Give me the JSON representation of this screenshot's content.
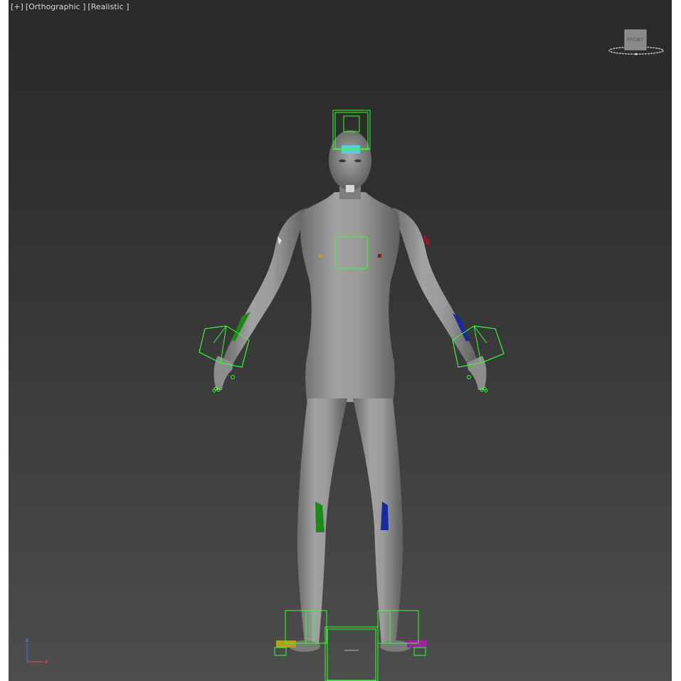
{
  "viewport": {
    "menu_plus": "[+]",
    "view_label": "[Orthographic ]",
    "shading_label": "[Realistic ]"
  },
  "viewcube": {
    "face_label": "FRONT"
  },
  "axis_tripod": {
    "z_label": "z",
    "x_label": "x"
  },
  "colors": {
    "gizmo_green": "#33ff33",
    "viewport_top": "#2a2a2a",
    "viewport_bottom": "#4d4d4d",
    "skin": "#9a9a9a",
    "bone_green": "#1a8a1a",
    "bone_blue": "#1a2a9a",
    "bone_yellow": "#b0a020",
    "bone_purple": "#a020a0",
    "head_cyan": "#5cc8e0"
  }
}
